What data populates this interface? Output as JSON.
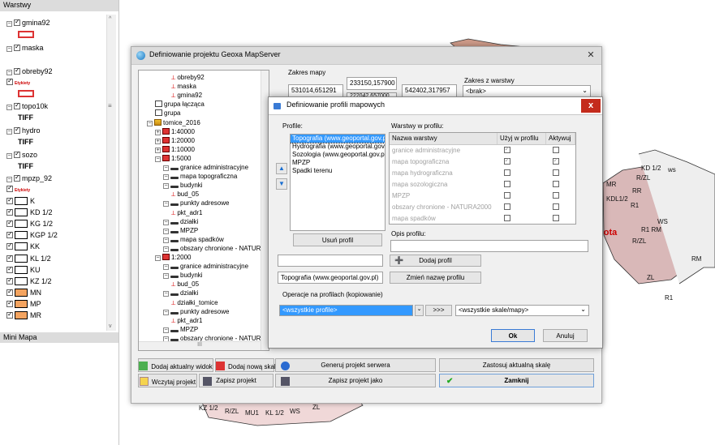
{
  "left_panel": {
    "header": "Warstwy",
    "footer": "Mini Mapa",
    "layers": [
      {
        "name": "gmina92",
        "checked": true,
        "expanded": true,
        "swatch": "#d33"
      },
      {
        "name": "maska",
        "checked": true,
        "expanded": true
      },
      {
        "name": "obreby92",
        "checked": true,
        "expanded": true,
        "label_tag": "Etykiety",
        "swatch": "#d33"
      },
      {
        "name": "topo10k",
        "checked": true,
        "expanded": true,
        "sub": "TIFF"
      },
      {
        "name": "hydro",
        "checked": true,
        "expanded": true,
        "sub": "TIFF"
      },
      {
        "name": "sozo",
        "checked": true,
        "expanded": true,
        "sub": "TIFF"
      },
      {
        "name": "mpzp_92",
        "checked": true,
        "expanded": true,
        "label_tag": "Etykiety"
      }
    ],
    "legend": [
      {
        "name": "K",
        "color": "#ffffff"
      },
      {
        "name": "KD 1/2",
        "color": "#ffffff"
      },
      {
        "name": "KG 1/2",
        "color": "#ffffff"
      },
      {
        "name": "KGP 1/2",
        "color": "#ffffff"
      },
      {
        "name": "KK",
        "color": "#ffffff"
      },
      {
        "name": "KL 1/2",
        "color": "#ffffff"
      },
      {
        "name": "KU",
        "color": "#ffffff"
      },
      {
        "name": "KZ 1/2",
        "color": "#ffffff"
      },
      {
        "name": "MN",
        "color": "#f4a460"
      },
      {
        "name": "MP",
        "color": "#f4a460"
      },
      {
        "name": "MR",
        "color": "#f4a460"
      }
    ]
  },
  "main_dialog": {
    "title": "Definiowanie projektu Geoxa MapServer",
    "zakres_mapy_label": "Zakres mapy",
    "coord_1": "531014,651291",
    "coord_2": "233150,157900",
    "coord_3": "542402,317957",
    "coord_4": "222042,657000",
    "zakres_z_warstwy_label": "Zakres z warstwy",
    "zakres_z_warstwy_value": "<brak>",
    "tree": [
      "obreby92",
      "maska",
      "gmina92",
      "grupa łącząca",
      "grupa",
      "tomice_2016",
      "1:40000",
      "1:20000",
      "1:10000",
      "1:5000",
      "granice administracyjne",
      "mapa topograficzna",
      "budynki",
      "bud_05",
      "punkty adresowe",
      "pkt_adr1",
      "działki",
      "MPZP",
      "mapa spadków",
      "obszary chronione - NATURA 2",
      "1:2000",
      "granice administracyjne",
      "budynki",
      "bud_05",
      "działki",
      "działki_tomice",
      "punkty adresowe",
      "pkt_adr1",
      "MPZP",
      "obszary chronione - NATURA 2"
    ],
    "buttons": {
      "dodaj_widok": "Dodaj aktualny widok",
      "dodaj_skale": "Dodaj nową skalę",
      "generuj": "Generuj projekt serwera",
      "zastosuj": "Zastosuj aktualną skalę",
      "wczytaj": "Wczytaj projekt",
      "zapisz": "Zapisz projekt",
      "zapisz_jako": "Zapisz projekt jako",
      "zamknij": "Zamknij"
    },
    "scroll_glyph": "III"
  },
  "profile_dialog": {
    "title": "Definiowanie profili mapowych",
    "close_glyph": "x",
    "profiles_label": "Profile:",
    "profiles": [
      "Topografia (www.geoportal.gov.pl)",
      "Hydrografia (www.geoportal.gov.",
      "Sozologia (www.geoportal.gov.pl)",
      "MPZP",
      "Spadki terenu"
    ],
    "selected_profile": 0,
    "usun_profil": "Usuń profil",
    "warstwy_label": "Warstwy w profilu:",
    "col_name": "Nazwa warstwy",
    "col_use": "Użyj w profilu",
    "col_active": "Aktywuj",
    "layers": [
      {
        "name": "granice administracyjne",
        "use": true,
        "active": false
      },
      {
        "name": "mapa topograficzna",
        "use": true,
        "active": true
      },
      {
        "name": "mapa hydrograficzna",
        "use": false,
        "active": false
      },
      {
        "name": "mapa sozologiczna",
        "use": false,
        "active": false
      },
      {
        "name": "MPZP",
        "use": false,
        "active": false
      },
      {
        "name": "obszary chronione - NATURA2000",
        "use": false,
        "active": false
      },
      {
        "name": "mapa spadków",
        "use": false,
        "active": false
      }
    ],
    "opis_label": "Opis profilu:",
    "opis_value": "",
    "new_profile_value": "",
    "dodaj_profil": "Dodaj profil",
    "current_name_value": "Topografia (www.geoportal.gov.pl)",
    "zmien_nazwe": "Zmień nazwę profilu",
    "operacje_label": "Operacje na profilach (kopiowanie)",
    "source_select": "<wszystkie profile>",
    "copy_btn": ">>>",
    "target_select": "<wszystkie skale/mapy>",
    "ok": "Ok",
    "anuluj": "Anuluj"
  },
  "map_labels": [
    "KD 1/2",
    "ws",
    "R/ZL",
    "MR",
    "RR",
    "KDL1/2",
    "gota",
    "R1",
    "R1 RM",
    "WS",
    "R/ZL",
    "ZL",
    "RM",
    "R1",
    "MU",
    "ZL",
    "R1",
    "KZ 1/2",
    "R/ZL",
    "MU1",
    "KL 1/2",
    "WS",
    "ZL"
  ]
}
